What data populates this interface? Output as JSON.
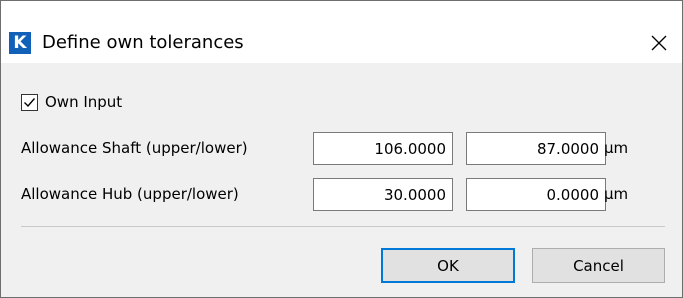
{
  "window": {
    "title": "Define own tolerances",
    "app_icon_letter": "K",
    "app_icon_color": "#1261b8"
  },
  "own_input": {
    "label": "Own Input",
    "checked": true
  },
  "rows": [
    {
      "label": "Allowance Shaft (upper/lower)",
      "upper": "106.0000",
      "lower": "87.0000",
      "unit": "μm"
    },
    {
      "label": "Allowance Hub (upper/lower)",
      "upper": "30.0000",
      "lower": "0.0000",
      "unit": "μm"
    }
  ],
  "buttons": {
    "ok_label": "OK",
    "cancel_label": "Cancel"
  },
  "colors": {
    "accent": "#0078d7",
    "content_background": "#f0f0f0"
  }
}
